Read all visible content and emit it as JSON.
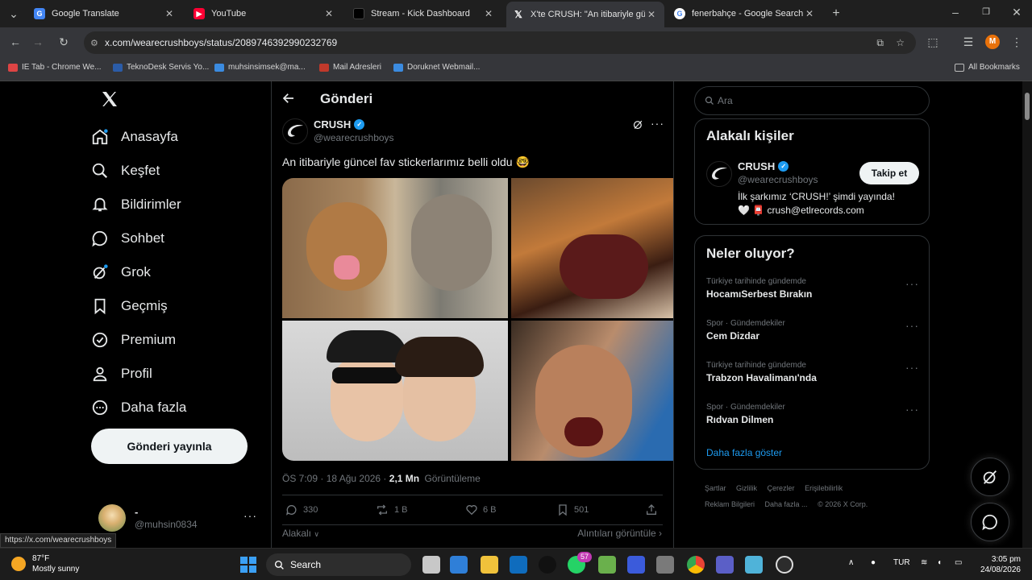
{
  "browser": {
    "tabs": [
      {
        "title": "Google Translate"
      },
      {
        "title": "YouTube"
      },
      {
        "title": "Stream - Kick Dashboard"
      },
      {
        "title": "X'te CRUSH: \"An itibariyle günc"
      },
      {
        "title": "fenerbahçe - Google Search"
      }
    ],
    "url": "x.com/wearecrushboys/status/2089746392990232769",
    "bookmarks": [
      {
        "label": "IE Tab - Chrome We..."
      },
      {
        "label": "TeknoDesk Servis Yo..."
      },
      {
        "label": "muhsinsimsek@ma..."
      },
      {
        "label": "Mail Adresleri"
      },
      {
        "label": "Doruknet Webmail..."
      }
    ],
    "all_bookmarks": "All Bookmarks",
    "profile_initial": "M",
    "status_url": "https://x.com/wearecrushboys"
  },
  "nav": {
    "items": [
      {
        "label": "Anasayfa"
      },
      {
        "label": "Keşfet"
      },
      {
        "label": "Bildirimler"
      },
      {
        "label": "Sohbet"
      },
      {
        "label": "Grok"
      },
      {
        "label": "Geçmiş"
      },
      {
        "label": "Premium"
      },
      {
        "label": "Profil"
      },
      {
        "label": "Daha fazla"
      }
    ],
    "post_button": "Gönderi yayınla",
    "account": {
      "name": "-",
      "handle": "@muhsin0834"
    }
  },
  "post": {
    "header": "Gönderi",
    "author": "CRUSH",
    "handle": "@wearecrushboys",
    "text": "An itibariyle güncel fav stickerlarımız belli oldu 🤓",
    "time": "ÖS 7:09 · 18 Ağu 2026 · ",
    "views_count": "2,1 Mn",
    "views_label": "Görüntüleme",
    "replies": "330",
    "reposts": "1 B",
    "likes": "6 B",
    "bookmarks": "501",
    "related": "Alakalı",
    "quotes": "Alıntıları görüntüle"
  },
  "sidebar": {
    "search_placeholder": "Ara",
    "related_title": "Alakalı kişiler",
    "person": {
      "name": "CRUSH",
      "handle": "@wearecrushboys",
      "bio1": "İlk şarkımız ‘CRUSH!’ şimdi yayında!",
      "bio2": "🤍 📮 crush@etlrecords.com",
      "follow": "Takip et"
    },
    "trends_title": "Neler oluyor?",
    "trends": [
      {
        "category": "Türkiye tarihinde gündemde",
        "name": "HocamıSerbest Bırakın"
      },
      {
        "category": "Spor · Gündemdekiler",
        "name": "Cem Dizdar"
      },
      {
        "category": "Türkiye tarihinde gündemde",
        "name": "Trabzon Havalimanı'nda"
      },
      {
        "category": "Spor · Gündemdekiler",
        "name": "Rıdvan Dilmen"
      }
    ],
    "show_more": "Daha fazla göster",
    "footer": [
      "Şartlar",
      "Gizlilik",
      "Çerezler",
      "Erişilebilirlik",
      "Reklam Bilgileri",
      "Daha fazla ...",
      "© 2026 X Corp."
    ]
  },
  "taskbar": {
    "temp": "87°F",
    "weather": "Mostly sunny",
    "search": "Search",
    "badge": "57",
    "lang": "TUR",
    "time": "3:05 pm",
    "date": "24/08/2026"
  },
  "colors": {
    "accent": "#1d9bf0",
    "verified": "#1d9bf0"
  }
}
